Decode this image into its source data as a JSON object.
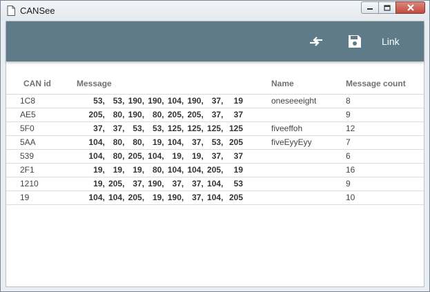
{
  "window": {
    "title": "CANSee"
  },
  "toolbar": {
    "swap_icon": "swap-arrows-icon",
    "save_icon": "floppy-save-icon",
    "link_label": "Link",
    "bg_color": "#5f7b89"
  },
  "table": {
    "columns": [
      "CAN id",
      "Message",
      "Name",
      "Message count"
    ],
    "rows": [
      {
        "id": "1C8",
        "message": [
          "53,",
          "53,",
          "190,",
          "190,",
          "104,",
          "190,",
          "37,",
          "19"
        ],
        "name": "oneseeeight",
        "count": "8"
      },
      {
        "id": "AE5",
        "message": [
          "205,",
          "80,",
          "190,",
          "80,",
          "205,",
          "205,",
          "37,",
          "37"
        ],
        "name": "",
        "count": "9"
      },
      {
        "id": "5F0",
        "message": [
          "37,",
          "37,",
          "53,",
          "53,",
          "125,",
          "125,",
          "125,",
          "125"
        ],
        "name": "fiveeffoh",
        "count": "12"
      },
      {
        "id": "5AA",
        "message": [
          "104,",
          "80,",
          "80,",
          "19,",
          "104,",
          "37,",
          "53,",
          "205"
        ],
        "name": "fiveEyyEyy",
        "count": "7"
      },
      {
        "id": "539",
        "message": [
          "104,",
          "80,",
          "205,",
          "104,",
          "19,",
          "19,",
          "37,",
          "37"
        ],
        "name": "",
        "count": "6"
      },
      {
        "id": "2F1",
        "message": [
          "19,",
          "19,",
          "19,",
          "80,",
          "104,",
          "104,",
          "205,",
          "19"
        ],
        "name": "",
        "count": "16"
      },
      {
        "id": "1210",
        "message": [
          "19,",
          "205,",
          "37,",
          "190,",
          "37,",
          "37,",
          "104,",
          "53"
        ],
        "name": "",
        "count": "9"
      },
      {
        "id": "19",
        "message": [
          "104,",
          "104,",
          "205,",
          "19,",
          "190,",
          "37,",
          "104,",
          "205"
        ],
        "name": "",
        "count": "10"
      }
    ]
  }
}
